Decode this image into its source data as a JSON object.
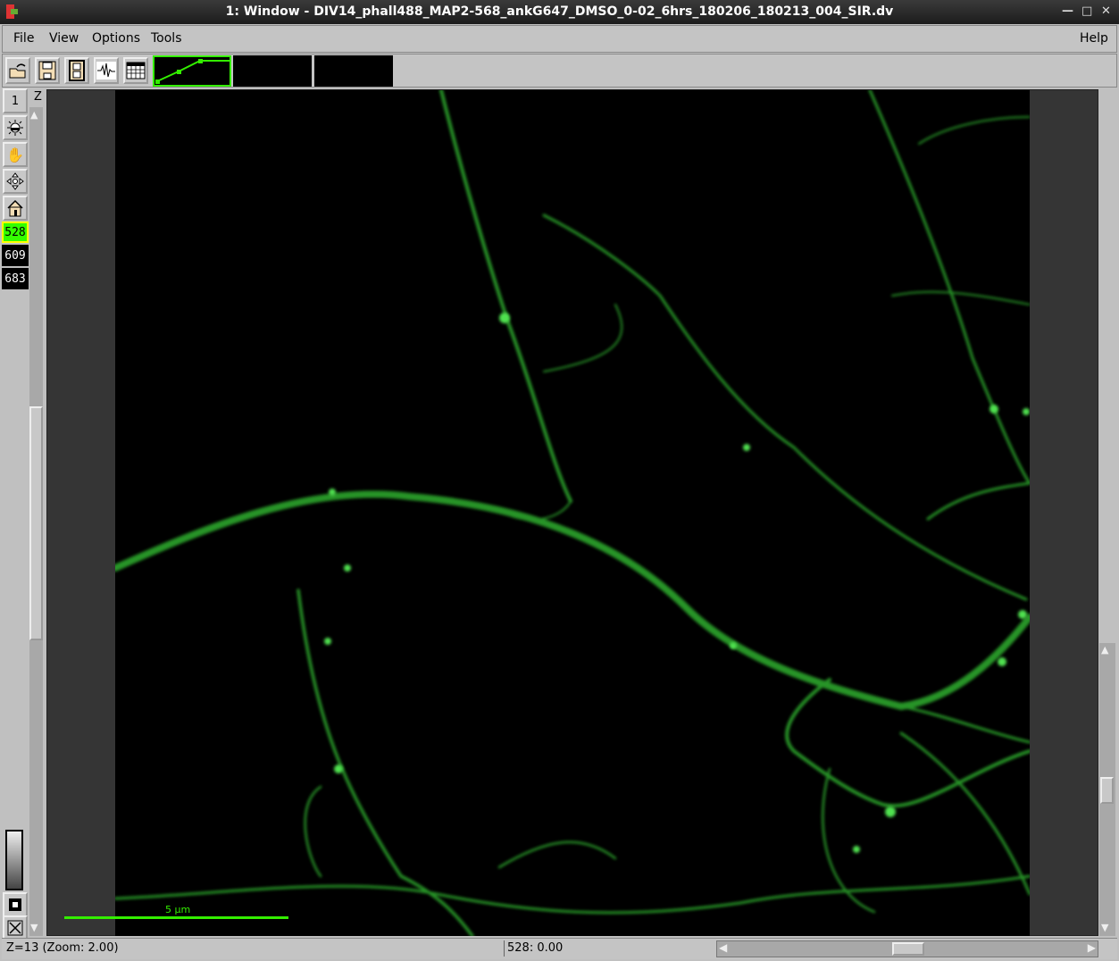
{
  "window": {
    "title": "1: Window - DIV14_phall488_MAP2-568_ankG647_DMSO_0-02_6hrs_180206_180213_004_SIR.dv",
    "controls": [
      "minimize",
      "maximize",
      "close"
    ]
  },
  "menu": {
    "file": "File",
    "view": "View",
    "options": "Options",
    "tools": "Tools",
    "help": "Help"
  },
  "toolbar": {
    "icons": [
      "open-icon",
      "save-icon",
      "movie-icon",
      "waveform-icon",
      "table-icon"
    ]
  },
  "sidebar": {
    "channel_top": "1",
    "z_label": "Z",
    "wavelengths": [
      {
        "label": "528",
        "color": "#33ff00",
        "active": true
      },
      {
        "label": "609",
        "active": false
      },
      {
        "label": "683",
        "active": false
      }
    ]
  },
  "image": {
    "scalebar_label": "5 µm",
    "accent": "#33ee33"
  },
  "status": {
    "left": "Z=13  (Zoom: 2.00)",
    "middle": "528: 0.00"
  }
}
